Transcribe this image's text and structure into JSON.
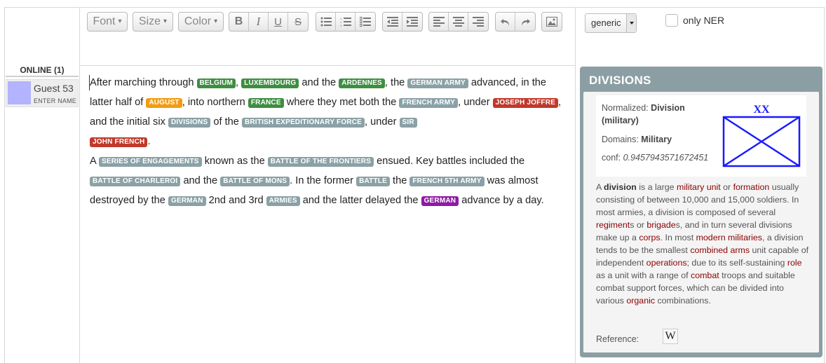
{
  "toolbar": {
    "font_label": "Font",
    "size_label": "Size",
    "color_label": "Color",
    "bold_label": "B",
    "italic_label": "I",
    "underline_label": "U",
    "strike_label": "S",
    "dropdown_glyph": "▾"
  },
  "ner": {
    "model_select_value": "generic",
    "only_ner_label": "only NER",
    "only_ner_checked": false
  },
  "online": {
    "title": "ONLINE (1)",
    "users": [
      {
        "name": "Guest 53",
        "action": "ENTER NAME",
        "avatar_color": "#b3b3ff"
      }
    ]
  },
  "editor": {
    "segments": [
      {
        "text": "After marching through "
      },
      {
        "tag": "BELGIUM",
        "color": "green"
      },
      {
        "text": ", "
      },
      {
        "tag": "LUXEMBOURG",
        "color": "green"
      },
      {
        "text": " and the "
      },
      {
        "tag": "ARDENNES",
        "color": "green"
      },
      {
        "text": ", the "
      },
      {
        "tag": "GERMAN ARMY",
        "color": "gray"
      },
      {
        "text": " advanced, in the latter half of "
      },
      {
        "tag": "AUGUST",
        "color": "orange"
      },
      {
        "text": ", into northern "
      },
      {
        "tag": "FRANCE",
        "color": "green"
      },
      {
        "text": " where they met both the "
      },
      {
        "tag": "FRENCH ARMY",
        "color": "gray"
      },
      {
        "text": ", under "
      },
      {
        "tag": "JOSEPH JOFFRE",
        "color": "red"
      },
      {
        "text": ", and the initial six "
      },
      {
        "tag": "DIVISIONS",
        "color": "gray"
      },
      {
        "text": " of the "
      },
      {
        "tag": "BRITISH EXPEDITIONARY FORCE",
        "color": "gray"
      },
      {
        "text": ", under "
      },
      {
        "tag": "SIR",
        "color": "gray"
      },
      {
        "break": true
      },
      {
        "tag": "JOHN FRENCH",
        "color": "red"
      },
      {
        "text": "."
      },
      {
        "break": true
      },
      {
        "text": "A "
      },
      {
        "tag": "SERIES OF ENGAGEMENTS",
        "color": "gray"
      },
      {
        "text": " known as the "
      },
      {
        "tag": "BATTLE OF THE FRONTIERS",
        "color": "gray"
      },
      {
        "text": " ensued. Key battles included the "
      },
      {
        "tag": "BATTLE OF CHARLEROI",
        "color": "gray"
      },
      {
        "text": " and the "
      },
      {
        "tag": "BATTLE OF MONS",
        "color": "gray"
      },
      {
        "text": ". In the former "
      },
      {
        "tag": "BATTLE",
        "color": "gray"
      },
      {
        "text": " the "
      },
      {
        "tag": "FRENCH 5TH ARMY",
        "color": "gray"
      },
      {
        "text": " was almost destroyed by the "
      },
      {
        "tag": "GERMAN",
        "color": "gray"
      },
      {
        "text": " 2nd and 3rd "
      },
      {
        "tag": "ARMIES",
        "color": "gray"
      },
      {
        "text": " and the latter delayed the "
      },
      {
        "tag": "GERMAN",
        "color": "purple"
      },
      {
        "text": " advance by a day."
      }
    ]
  },
  "panel": {
    "title": "DIVISIONS",
    "normalized_label": "Normalized:",
    "normalized_value": "Division",
    "normalized_value_cont": "(military)",
    "domains_label": "Domains:",
    "domains_value": "Military",
    "conf_label": "conf:",
    "conf_value": "0.9457943571672451",
    "symbol_text": "XX",
    "description": [
      {
        "t": "A "
      },
      {
        "t": "division",
        "style": "bold"
      },
      {
        "t": " is a large "
      },
      {
        "t": "military unit",
        "style": "link"
      },
      {
        "t": " or "
      },
      {
        "t": "formation",
        "style": "link"
      },
      {
        "t": " usually consisting of between 10,000 and 15,000 soldiers. In most armies, a division is composed of several "
      },
      {
        "t": "regiment",
        "style": "link"
      },
      {
        "t": "s or "
      },
      {
        "t": "brigade",
        "style": "link"
      },
      {
        "t": "s, and in turn several divisions make up a "
      },
      {
        "t": "corps",
        "style": "link"
      },
      {
        "t": ". In most "
      },
      {
        "t": "modern militaries",
        "style": "link"
      },
      {
        "t": ", a division tends to be the smallest "
      },
      {
        "t": "combined arms",
        "style": "link"
      },
      {
        "t": " unit capable of independent "
      },
      {
        "t": "operations",
        "style": "link"
      },
      {
        "t": "; due to its self-sustaining "
      },
      {
        "t": "role",
        "style": "link"
      },
      {
        "t": " as a unit with a range of "
      },
      {
        "t": "combat",
        "style": "link"
      },
      {
        "t": " troops and suitable combat support forces, which can be divided into various "
      },
      {
        "t": "organic",
        "style": "link"
      },
      {
        "t": " combinations."
      }
    ],
    "reference_label": "Reference:",
    "reference_icon": "W"
  },
  "colors": {
    "green": "#3e8e41",
    "gray": "#8aa1a6",
    "orange": "#f39c12",
    "red": "#c0392b",
    "purple": "#8e1aa5",
    "panel_bg": "#8b9ea3",
    "link": "#8b0000"
  }
}
